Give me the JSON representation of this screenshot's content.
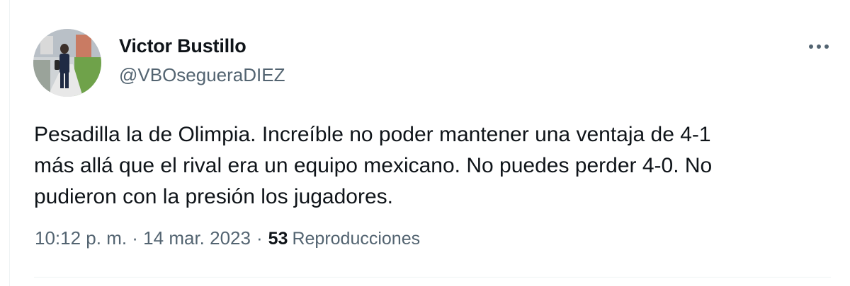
{
  "tweet": {
    "author": {
      "name": "Victor Bustillo",
      "handle": "@VBOsegueraDIEZ"
    },
    "text": "Pesadilla la de Olimpia. Increíble no poder mantener una ventaja de 4-1\nmás allá que el rival era un equipo mexicano. No puedes perder 4-0. No\npudieron con la presión los jugadores.",
    "timestamp": "10:12 p. m. · 14 mar. 2023",
    "separator": "·",
    "views_count": "53",
    "views_label": "Reproducciones",
    "more_icon": "more-horizontal-icon"
  },
  "colors": {
    "text_primary": "#0f1419",
    "text_secondary": "#536471",
    "divider": "#eff3f4"
  }
}
